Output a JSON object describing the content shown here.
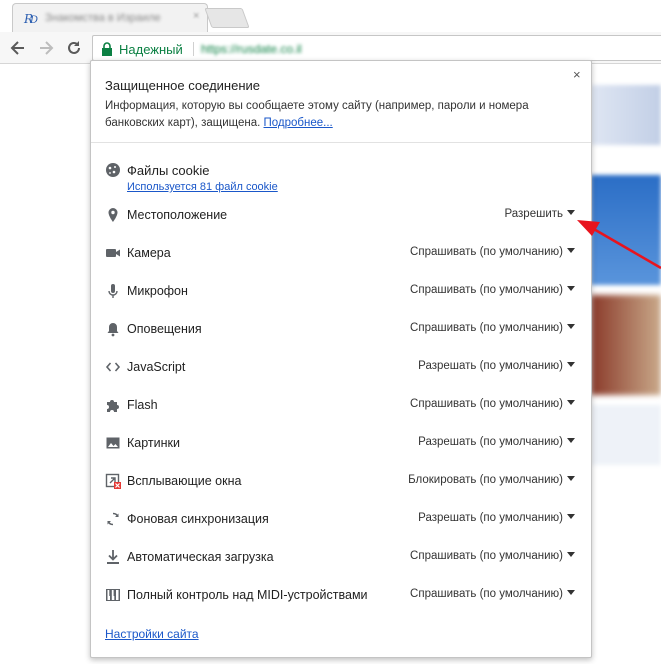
{
  "browser": {
    "tab_title": "Знакомства в Израиле",
    "tab_close": "×",
    "secure_label": "Надежный",
    "url": "https://rusdate.co.il"
  },
  "popup": {
    "close": "×",
    "title": "Защищенное соединение",
    "description": "Информация, которую вы сообщаете этому сайту (например, пароли и номера банковских карт), защищена.",
    "more_link": "Подробнее...",
    "cookies": {
      "label": "Файлы cookie",
      "sub": "Используется 81 файл cookie"
    },
    "permissions": [
      {
        "icon": "location-pin-icon",
        "label": "Местоположение",
        "value": "Разрешить"
      },
      {
        "icon": "camera-icon",
        "label": "Камера",
        "value": "Спрашивать (по умолчанию)"
      },
      {
        "icon": "microphone-icon",
        "label": "Микрофон",
        "value": "Спрашивать (по умолчанию)"
      },
      {
        "icon": "bell-icon",
        "label": "Оповещения",
        "value": "Спрашивать (по умолчанию)"
      },
      {
        "icon": "code-icon",
        "label": "JavaScript",
        "value": "Разрешать (по умолчанию)"
      },
      {
        "icon": "puzzle-icon",
        "label": "Flash",
        "value": "Спрашивать (по умолчанию)"
      },
      {
        "icon": "image-icon",
        "label": "Картинки",
        "value": "Разрешать (по умолчанию)"
      },
      {
        "icon": "popup-blocked-icon",
        "label": "Всплывающие окна",
        "value": "Блокировать (по умолчанию)"
      },
      {
        "icon": "sync-icon",
        "label": "Фоновая синхронизация",
        "value": "Разрешать (по умолчанию)"
      },
      {
        "icon": "download-icon",
        "label": "Автоматическая загрузка",
        "value": "Спрашивать (по умолчанию)"
      },
      {
        "icon": "midi-piano-icon",
        "label": "Полный контроль над MIDI-устройствами",
        "value": "Спрашивать (по умолчанию)"
      }
    ],
    "site_settings_link": "Настройки сайта"
  },
  "colors": {
    "secure_green": "#0b8043",
    "link_blue": "#1a57c9",
    "annotation_arrow": "#e8141e"
  }
}
